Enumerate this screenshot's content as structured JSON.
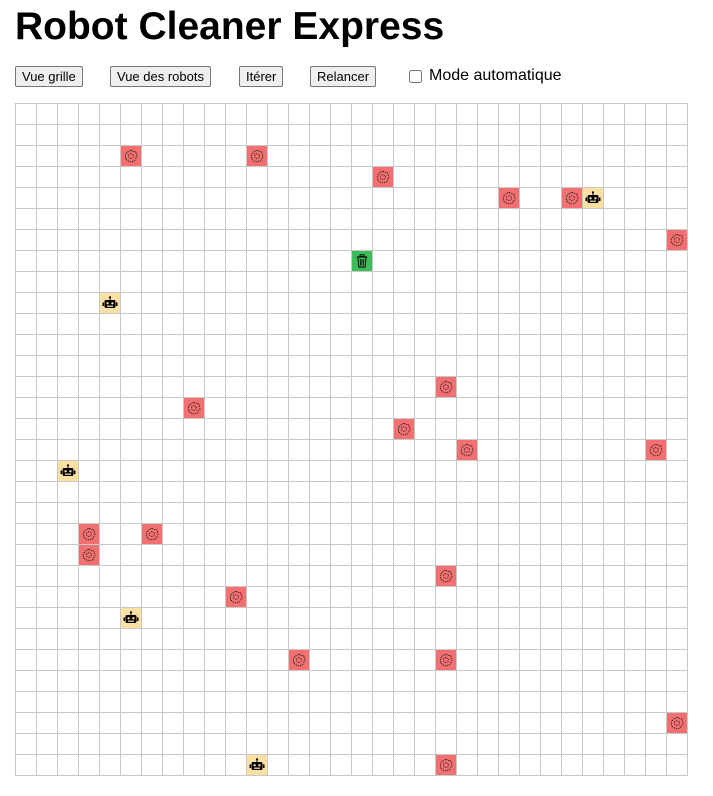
{
  "app": {
    "title": "Robot Cleaner Express"
  },
  "toolbar": {
    "buttons": [
      {
        "id": "grid-view",
        "label": "Vue grille"
      },
      {
        "id": "robots-view",
        "label": "Vue des robots"
      },
      {
        "id": "iterate",
        "label": "Itérer"
      },
      {
        "id": "restart",
        "label": "Relancer"
      }
    ],
    "auto_mode": {
      "label": "Mode automatique",
      "checked": false
    }
  },
  "grid": {
    "cols": 32,
    "rows": 32,
    "colors": {
      "dirt": "#f47070",
      "robot": "#fbe0a4",
      "bin": "#3dbd5a",
      "line": "#c8c8c8"
    },
    "icons": {
      "dirt": "dust-icon",
      "robot": "robot-icon",
      "bin": "trash-can-icon"
    },
    "dirt": [
      [
        5,
        2
      ],
      [
        11,
        2
      ],
      [
        17,
        3
      ],
      [
        23,
        4
      ],
      [
        26,
        4
      ],
      [
        31,
        6
      ],
      [
        20,
        13
      ],
      [
        8,
        14
      ],
      [
        18,
        15
      ],
      [
        21,
        16
      ],
      [
        30,
        16
      ],
      [
        3,
        20
      ],
      [
        6,
        20
      ],
      [
        3,
        21
      ],
      [
        20,
        22
      ],
      [
        10,
        23
      ],
      [
        13,
        26
      ],
      [
        20,
        26
      ],
      [
        31,
        29
      ],
      [
        20,
        31
      ]
    ],
    "robots": [
      [
        27,
        4
      ],
      [
        4,
        9
      ],
      [
        2,
        17
      ],
      [
        5,
        24
      ],
      [
        11,
        31
      ]
    ],
    "bins": [
      [
        16,
        7
      ]
    ]
  }
}
